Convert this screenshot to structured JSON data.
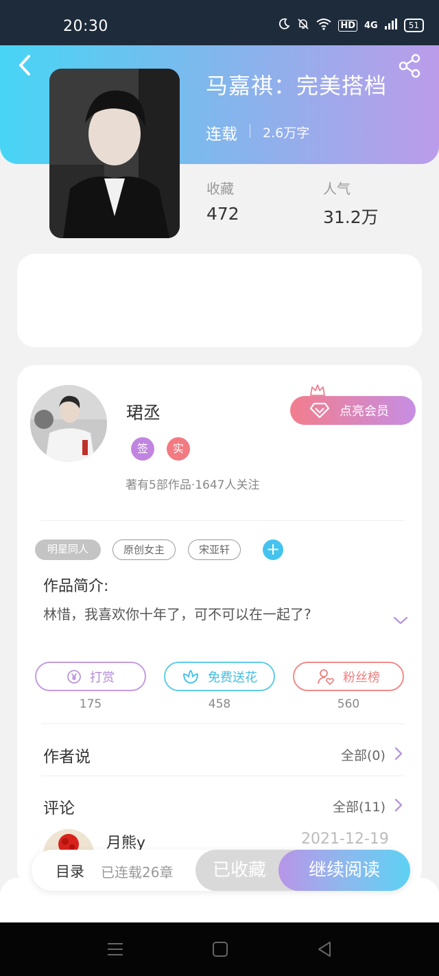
{
  "status_bar": {
    "time": "20:30",
    "network": "4G",
    "hd": "HD",
    "battery": "51"
  },
  "book": {
    "title": "马嘉祺：完美搭档",
    "status": "连载",
    "word_count": "2.6万字",
    "favorites_label": "收藏",
    "favorites_value": "472",
    "popularity_label": "人气",
    "popularity_value": "31.2万"
  },
  "author": {
    "name": "珺丞",
    "badge_sign": "签",
    "badge_real": "实",
    "meta": "著有5部作品·1647人关注",
    "vip_label": "点亮会员"
  },
  "tags": [
    "明星同人",
    "原创女主",
    "宋亚轩"
  ],
  "tag_add": "+",
  "intro": {
    "label": "作品简介:",
    "text": "林惜，我喜欢你十年了，可不可以在一起了?"
  },
  "actions": [
    {
      "label": "打赏",
      "count": "175",
      "icon": "coin-icon"
    },
    {
      "label": "免费送花",
      "count": "458",
      "icon": "flower-icon"
    },
    {
      "label": "粉丝榜",
      "count": "560",
      "icon": "user-heart-icon"
    }
  ],
  "author_says": {
    "title": "作者说",
    "more": "全部(0)"
  },
  "comments": {
    "title": "评论",
    "more": "全部(11)",
    "first": {
      "user": "月熊y",
      "date": "2021-12-19"
    }
  },
  "bottom_bar": {
    "toc_label": "目录",
    "toc_sub": "已连载26章",
    "favorited_label": "已收藏",
    "read_label": "继续阅读"
  },
  "colors": {
    "header_gradient_start": "#47d5f5",
    "header_gradient_end": "#bc9cea",
    "accent_purple": "#c184e0",
    "accent_red": "#f27a82",
    "accent_blue": "#45c3ef"
  }
}
